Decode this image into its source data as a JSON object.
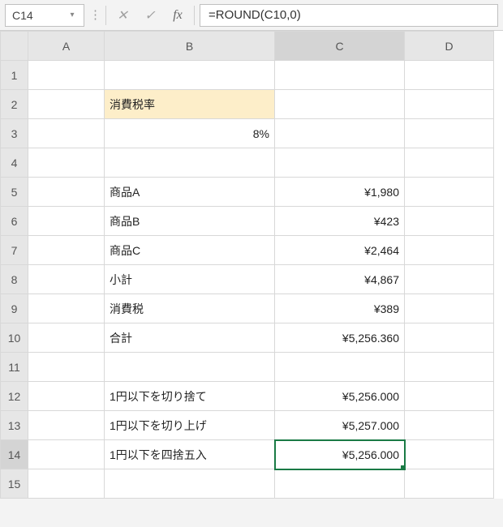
{
  "formulaBar": {
    "nameBox": "C14",
    "fx": "fx",
    "formula": "=ROUND(C10,0)"
  },
  "columns": {
    "A": "A",
    "B": "B",
    "C": "C",
    "D": "D"
  },
  "rowHeaders": [
    "1",
    "2",
    "3",
    "4",
    "5",
    "6",
    "7",
    "8",
    "9",
    "10",
    "11",
    "12",
    "13",
    "14",
    "15"
  ],
  "cells": {
    "B2": "消費税率",
    "B3": "8%",
    "B5": "商品A",
    "C5": "¥1,980",
    "B6": "商品B",
    "C6": "¥423",
    "B7": "商品C",
    "C7": "¥2,464",
    "B8": "小計",
    "C8": "¥4,867",
    "B9": "消費税",
    "C9": "¥389",
    "B10": "合計",
    "C10": "¥5,256.360",
    "B12": "1円以下を切り捨て",
    "C12": "¥5,256.000",
    "B13": "1円以下を切り上げ",
    "C13": "¥5,257.000",
    "B14": "1円以下を四捨五入",
    "C14": "¥5,256.000"
  },
  "activeCell": "C14",
  "colWidths": {
    "row": 34,
    "A": 94,
    "B": 210,
    "C": 160,
    "D": 110
  }
}
